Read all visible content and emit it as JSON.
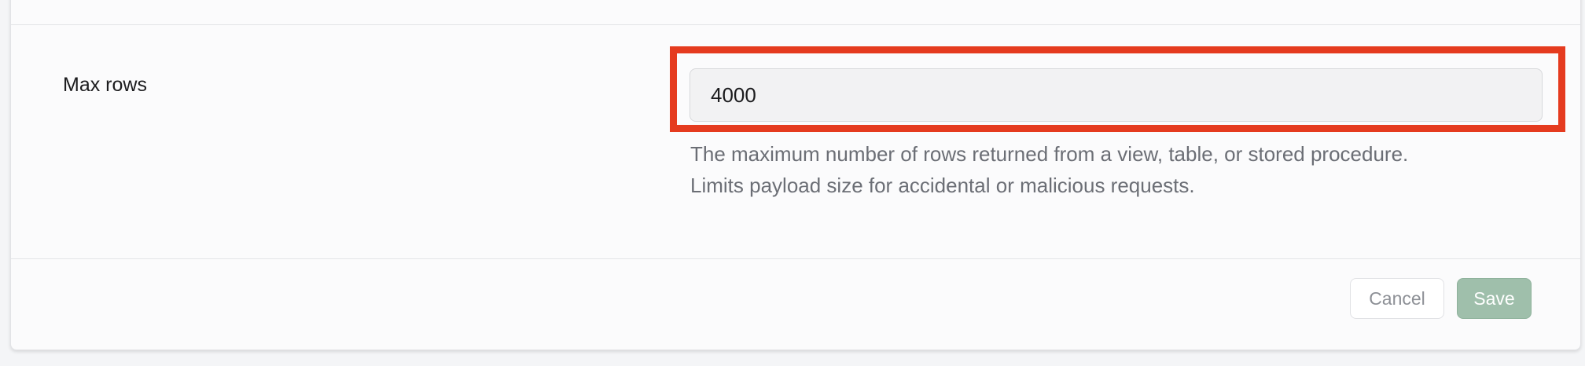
{
  "field": {
    "label": "Max rows",
    "value": "4000",
    "help_line1": "The maximum number of rows returned from a view, table, or stored procedure.",
    "help_line2": "Limits payload size for accidental or malicious requests."
  },
  "actions": {
    "cancel_label": "Cancel",
    "save_label": "Save"
  },
  "colors": {
    "highlight": "#e53b1f",
    "save_button": "#9fbfab"
  }
}
